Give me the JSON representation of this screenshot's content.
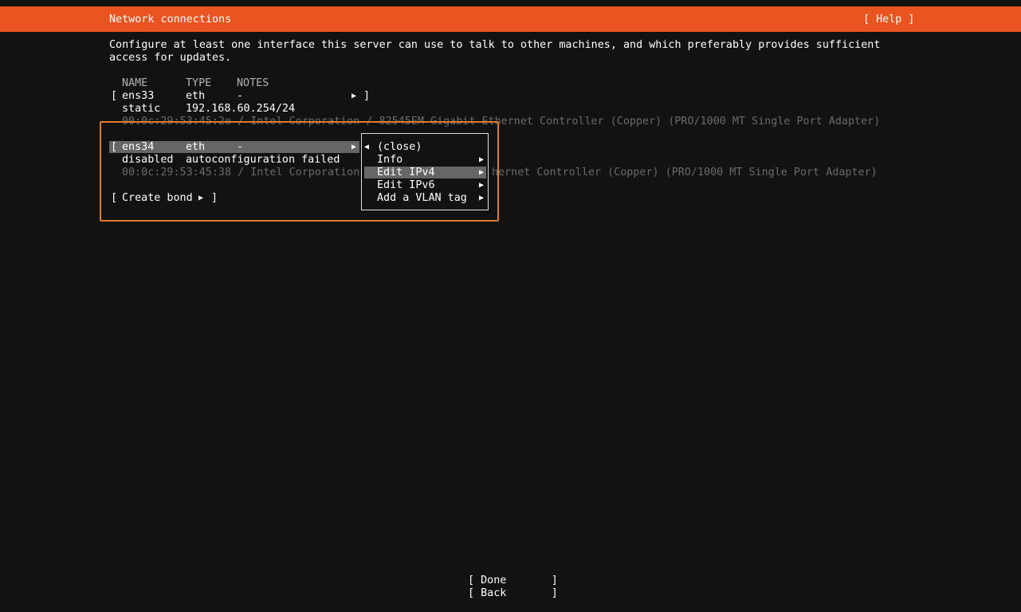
{
  "header": {
    "title": "Network connections",
    "help": "[ Help ]",
    "accent_color": "#e95420"
  },
  "intro": {
    "line1": "Configure at least one interface this server can use to talk to other machines, and which preferably provides sufficient",
    "line2": "access for updates."
  },
  "columns": {
    "name": "NAME",
    "type": "TYPE",
    "notes": "NOTES"
  },
  "interfaces": [
    {
      "open": "[",
      "name": "ens33",
      "type": "eth",
      "notes": "-",
      "arrow": "▶",
      "close": "]",
      "mode": "static",
      "address": "192.168.60.254/24",
      "hw": "00:0c:29:53:45:2e / Intel Corporation / 82545EM Gigabit Ethernet Controller (Copper) (PRO/1000 MT Single Port Adapter)"
    },
    {
      "open": "[",
      "name": "ens34",
      "type": "eth",
      "notes": "-",
      "arrow": "▶",
      "mode": "disabled",
      "address": "autoconfiguration failed",
      "hw_left": "00:0c:29:53:45:38 / Intel Corporation",
      "hw_right": "hernet Controller (Copper) (PRO/1000 MT Single Port Adapter)"
    }
  ],
  "create_bond": {
    "open": "[",
    "label": "Create bond",
    "arrow": "▶",
    "close": "]"
  },
  "context_menu": {
    "items": [
      {
        "label": "(close)",
        "arrow": "◀"
      },
      {
        "label": "Info",
        "arrow": "▶"
      },
      {
        "label": "Edit IPv4",
        "arrow": "▶"
      },
      {
        "label": "Edit IPv6",
        "arrow": "▶"
      },
      {
        "label": "Add a VLAN tag",
        "arrow": "▶"
      }
    ]
  },
  "footer": {
    "done": "[ Done       ]",
    "back": "[ Back       ]"
  }
}
